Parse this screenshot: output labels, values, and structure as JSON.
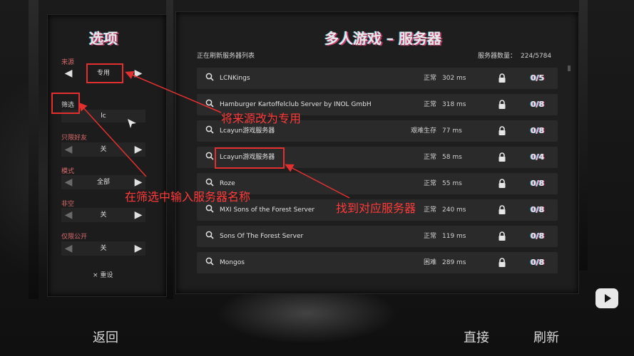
{
  "left_panel": {
    "title": "选项",
    "source": {
      "label": "来源",
      "value": "专用"
    },
    "filter": {
      "label": "筛选",
      "value": "lc"
    },
    "friends_only": {
      "label": "只限好友",
      "value": "关"
    },
    "mode": {
      "label": "模式",
      "value": "全部"
    },
    "non_empty": {
      "label": "非空",
      "value": "关"
    },
    "public_only": {
      "label": "仅限公开",
      "value": "关"
    },
    "reset": {
      "icon": "×",
      "label": "重设"
    }
  },
  "main_panel": {
    "title": "多人游戏 – 服务器",
    "refresh_status": "正在刷新服务器列表",
    "server_count_label": "服务器数量：",
    "server_count": "224/5784",
    "servers": [
      {
        "name": "LCNKings",
        "status": "正常",
        "ping": "302 ms",
        "players": "0/5"
      },
      {
        "name": "Hamburger Kartoffelclub Server by INOL GmbH",
        "status": "正常",
        "ping": "318 ms",
        "players": "0/8"
      },
      {
        "name": "Lcayun游戏服务器",
        "status": "艰难生存",
        "ping": "77 ms",
        "players": "0/8"
      },
      {
        "name": "Lcayun游戏服务器",
        "status": "正常",
        "ping": "58 ms",
        "players": "0/4"
      },
      {
        "name": "Roze",
        "status": "正常",
        "ping": "55 ms",
        "players": "0/8"
      },
      {
        "name": "MXI Sons of the Forest Server",
        "status": "正常",
        "ping": "240 ms",
        "players": "0/8"
      },
      {
        "name": "Sons Of The Forest Server",
        "status": "正常",
        "ping": "119 ms",
        "players": "0/8"
      },
      {
        "name": "Mongos",
        "status": "困难",
        "ping": "289 ms",
        "players": "0/8"
      }
    ]
  },
  "annotations": {
    "source_change": "将来源改为专用",
    "enter_name": "在筛选中输入服务器名称",
    "find_server": "找到对应服务器"
  },
  "bottom": {
    "back": "返回",
    "direct": "直接",
    "refresh": "刷新"
  },
  "colors": {
    "highlight": "#e23030",
    "annotation_text": "#ff3b3b"
  }
}
